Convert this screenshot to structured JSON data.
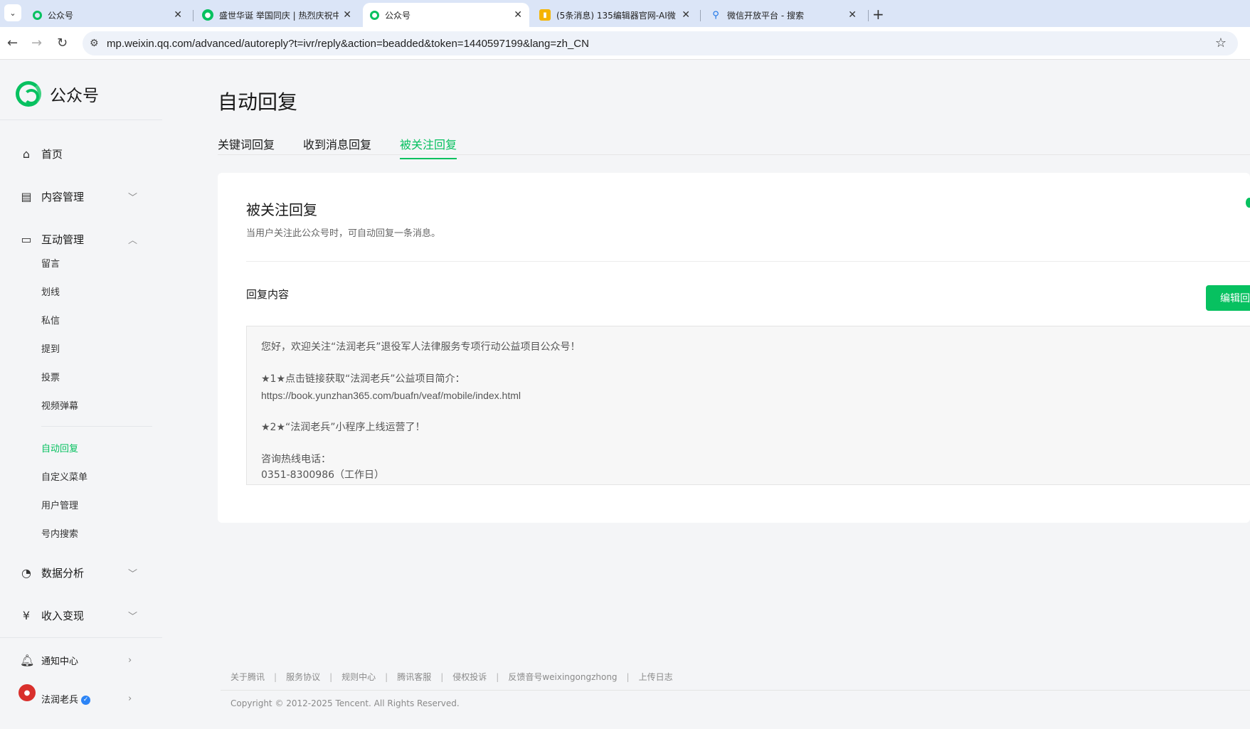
{
  "browser": {
    "tabs": [
      {
        "title": "公众号",
        "icon": "wechat-mp-icon",
        "active": false
      },
      {
        "title": "盛世华诞 举国同庆 | 热烈庆祝中",
        "icon": "wechat-icon",
        "active": false
      },
      {
        "title": "公众号",
        "icon": "wechat-mp-icon",
        "active": true
      },
      {
        "title": "(5条消息) 135编辑器官网-AI微",
        "icon": "editor135-icon",
        "active": false
      },
      {
        "title": "微信开放平台 - 搜索",
        "icon": "search-icon",
        "active": false
      }
    ],
    "close_glyph": "✕",
    "new_tab_glyph": "+",
    "url": "mp.weixin.qq.com/advanced/autoreply?t=ivr/reply&action=beadded&token=1440597199&lang=zh_CN"
  },
  "sidebar": {
    "brand": "公众号",
    "home": "首页",
    "content_mgmt": "内容管理",
    "interaction_mgmt": "互动管理",
    "interaction_items": [
      "留言",
      "划线",
      "私信",
      "提到",
      "投票",
      "视频弹幕"
    ],
    "tool_items": [
      "自动回复",
      "自定义菜单",
      "用户管理",
      "号内搜索"
    ],
    "active_item": "自动回复",
    "data_analysis": "数据分析",
    "monetization": "收入变现",
    "notifications": "通知中心",
    "account_name": "法润老兵"
  },
  "main": {
    "page_title": "自动回复",
    "tabs": [
      "关键词回复",
      "收到消息回复",
      "被关注回复"
    ],
    "active_tab": "被关注回复",
    "card_title": "被关注回复",
    "card_desc": "当用户关注此公众号时，可自动回复一条消息。",
    "section_label": "回复内容",
    "edit_button": "编辑回",
    "reply_lines": [
      "您好，欢迎关注“法润老兵”退役军人法律服务专项行动公益项目公众号！",
      "",
      "★1★点击链接获取“法润老兵”公益项目简介：",
      "https://book.yunzhan365.com/buafn/veaf/mobile/index.html",
      "",
      "★2★“法润老兵”小程序上线运营了！",
      "",
      "咨询热线电话：",
      "0351-8300986（工作日）"
    ]
  },
  "footer": {
    "links": [
      "关于腾讯",
      "服务协议",
      "规则中心",
      "腾讯客服",
      "侵权投诉",
      "反馈音号weixingongzhong",
      "上传日志"
    ],
    "separator": "|",
    "copyright": "Copyright © 2012-2025 Tencent. All Rights Reserved."
  },
  "colors": {
    "accent": "#07c160",
    "page_bg": "#f4f5f7",
    "tabbar_bg": "#dbe5f7"
  }
}
